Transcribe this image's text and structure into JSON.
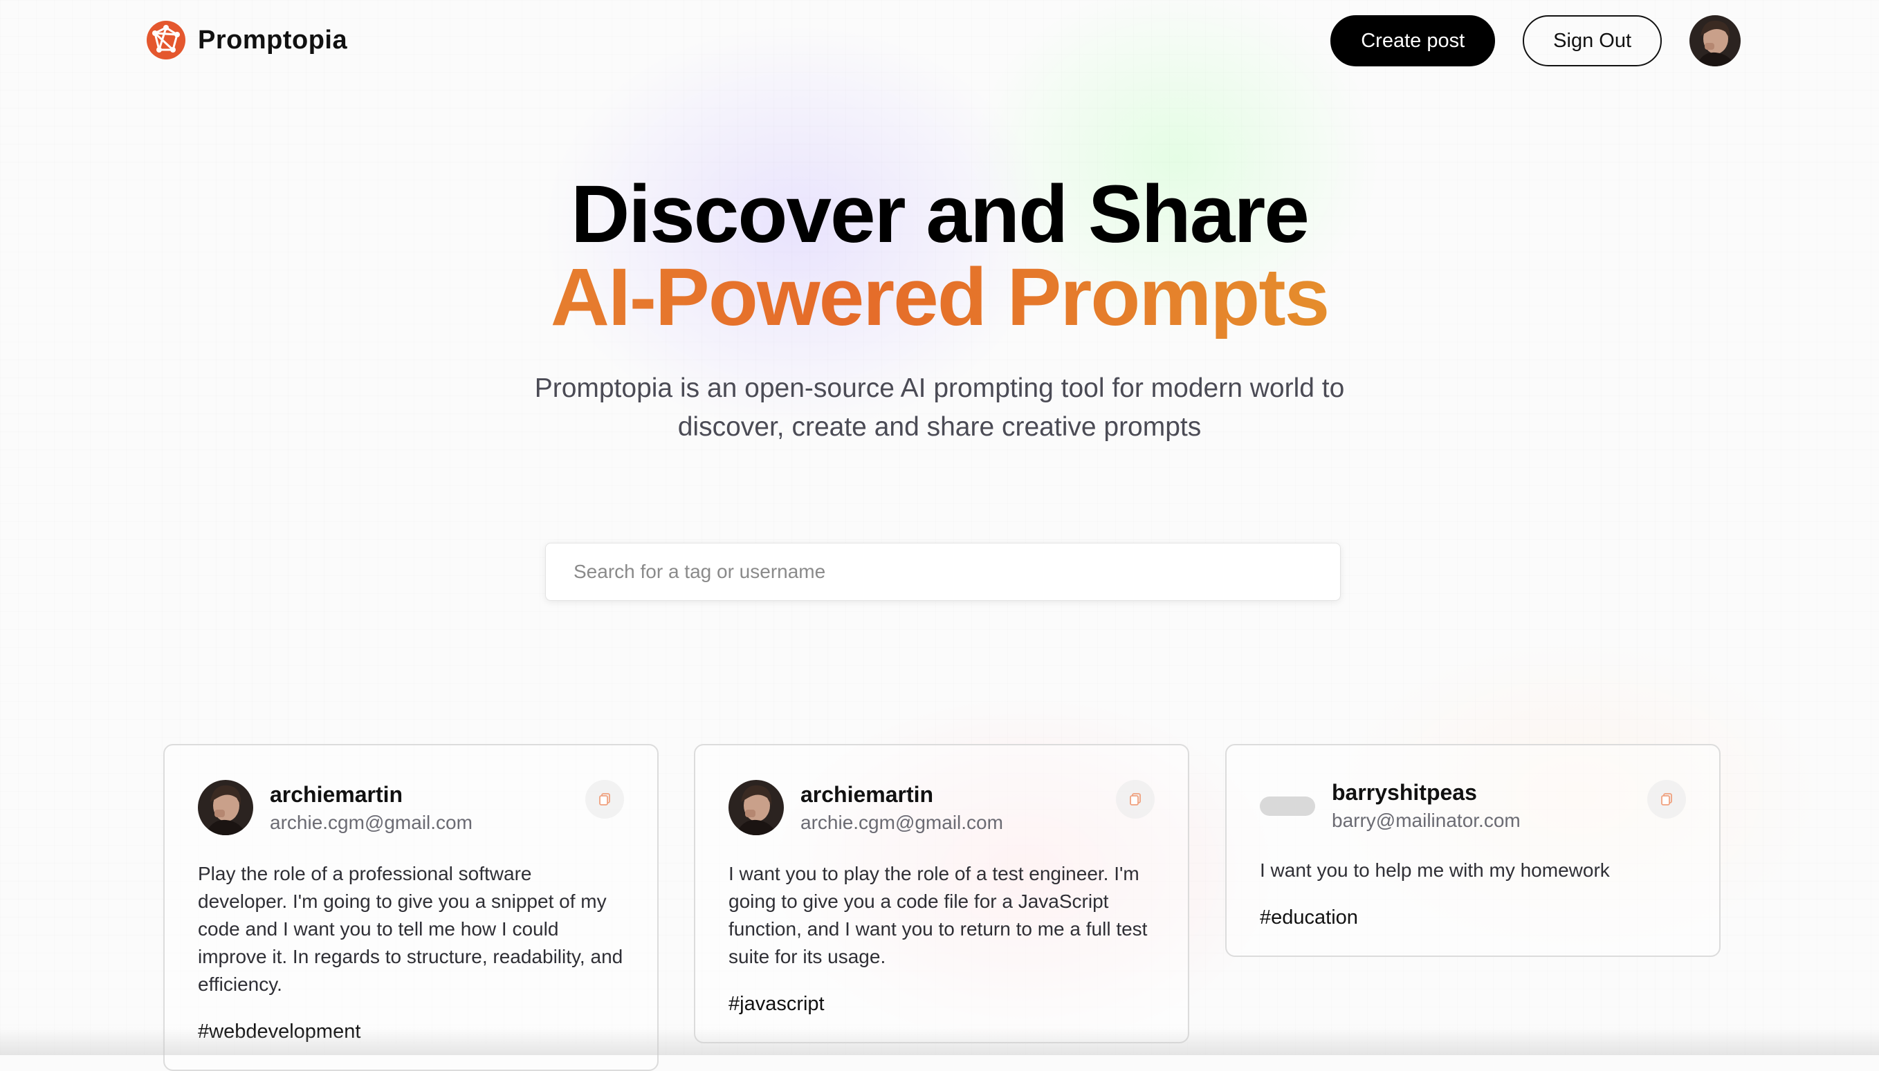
{
  "brand": {
    "name": "Promptopia",
    "logo_icon": "globe-network-icon",
    "accent": "#e4572e"
  },
  "nav": {
    "create_label": "Create post",
    "signout_label": "Sign Out",
    "avatar_icon": "user-avatar"
  },
  "hero": {
    "title_line1": "Discover and Share",
    "title_line2": "AI-Powered Prompts",
    "description": "Promptopia is an open-source AI prompting tool for modern world to discover, create and share creative prompts"
  },
  "search": {
    "placeholder": "Search for a tag or username",
    "value": ""
  },
  "prompts": [
    {
      "username": "archiemartin",
      "email": "archie.cgm@gmail.com",
      "text": "Play the role of a professional software developer. I'm going to give you a snippet of my code and I want you to tell me how I could improve it. In regards to structure, readability, and efficiency.",
      "tag": "#webdevelopment"
    },
    {
      "username": "archiemartin",
      "email": "archie.cgm@gmail.com",
      "text": "I want you to play the role of a test engineer. I'm going to give you a code file for a JavaScript function, and I want you to return to me a full test suite for its usage.",
      "tag": "#javascript"
    },
    {
      "username": "barryshitpeas",
      "email": "barry@mailinator.com",
      "text": "I want you to help me with my homework",
      "tag": "#education"
    }
  ],
  "colors": {
    "gradient_start": "#e9a136",
    "gradient_mid": "#e56b2a",
    "gradient_end": "#e2b03a",
    "button_dark": "#000000"
  }
}
